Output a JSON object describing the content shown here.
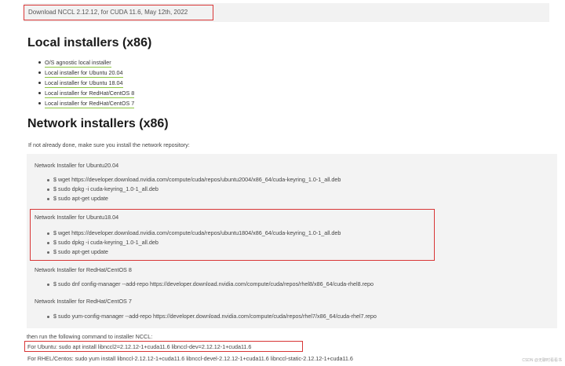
{
  "banner": {
    "text": "Download NCCL 2.12.12, for CUDA 11.6, May 12th, 2022"
  },
  "local": {
    "heading": "Local installers (x86)",
    "items": [
      "O/S agnostic local installer",
      "Local installer for Ubuntu 20.04",
      "Local installer for Ubuntu 18.04",
      "Local installer for RedHat/CentOS 8",
      "Local installer for RedHat/CentOS 7"
    ]
  },
  "network": {
    "heading": "Network installers (x86)",
    "intro": "If not already done, make sure you install the network repository:",
    "sections": [
      {
        "title": "Network Installer for Ubuntu20.04",
        "commands": [
          "$ wget https://developer.download.nvidia.com/compute/cuda/repos/ubuntu2004/x86_64/cuda-keyring_1.0-1_all.deb",
          "$ sudo dpkg -i cuda-keyring_1.0-1_all.deb",
          "$ sudo apt-get update"
        ]
      },
      {
        "title": "Network Installer for Ubuntu18.04",
        "commands": [
          "$ wget https://developer.download.nvidia.com/compute/cuda/repos/ubuntu1804/x86_64/cuda-keyring_1.0-1_all.deb",
          "$ sudo dpkg -i cuda-keyring_1.0-1_all.deb",
          "$ sudo apt-get update"
        ]
      },
      {
        "title": "Network Installer for RedHat/CentOS 8",
        "commands": [
          "$ sudo dnf config-manager --add-repo https://developer.download.nvidia.com/compute/cuda/repos/rhel8/x86_64/cuda-rhel8.repo"
        ]
      },
      {
        "title": "Network Installer for RedHat/CentOS 7",
        "commands": [
          "$ sudo yum-config-manager --add-repo https://developer.download.nvidia.com/compute/cuda/repos/rhel7/x86_64/cuda-rhel7.repo"
        ]
      }
    ]
  },
  "followup": {
    "intro": "then run the following command to installer NCCL:",
    "ubuntu": "For Ubuntu: sudo apt install libnccl2=2.12.12-1+cuda11.6 libnccl-dev=2.12.12-1+cuda11.6",
    "rhel": "For RHEL/Centos: sudo yum install libnccl-2.12.12-1+cuda11.6 libnccl-devel-2.12.12-1+cuda11.6 libnccl-static-2.12.12-1+cuda11.6"
  },
  "watermark": "CSDN @无聊时看看书"
}
